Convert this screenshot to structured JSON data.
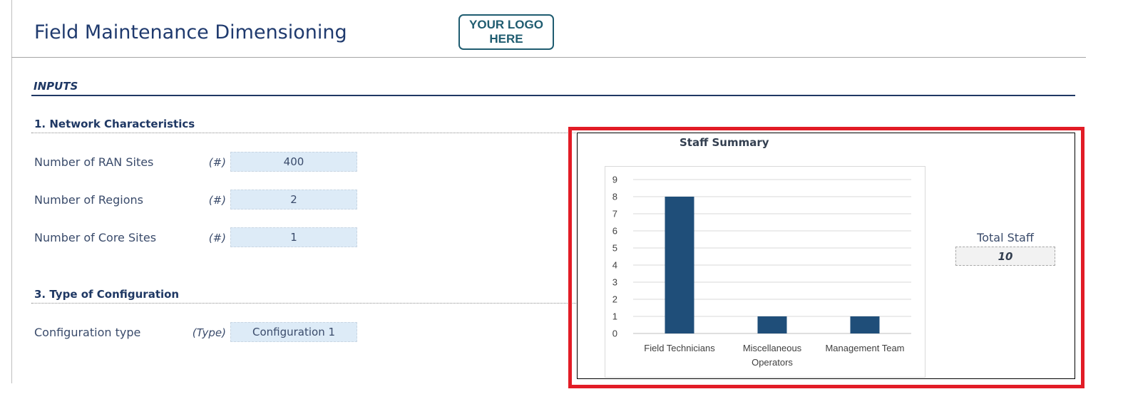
{
  "header": {
    "title": "Field Maintenance Dimensioning",
    "logo_line1": "YOUR LOGO",
    "logo_line2": "HERE"
  },
  "inputs_label": "INPUTS",
  "sections": [
    {
      "title": "1. Network Characteristics",
      "rows": [
        {
          "label": "Number of RAN Sites",
          "unit": "(#)",
          "value": "400"
        },
        {
          "label": "Number of Regions",
          "unit": "(#)",
          "value": "2"
        },
        {
          "label": "Number of Core Sites",
          "unit": "(#)",
          "value": "1"
        }
      ]
    },
    {
      "title": "3. Type of Configuration",
      "rows": [
        {
          "label": "Configuration type",
          "unit": "(Type)",
          "value": "Configuration 1"
        }
      ]
    }
  ],
  "summary": {
    "total_label": "Total Staff",
    "total_value": "10"
  },
  "colors": {
    "bar": "#1f4e79",
    "highlight": "#e21c26",
    "input_fill": "#ddebf7"
  },
  "chart_data": {
    "type": "bar",
    "title": "Staff Summary",
    "categories": [
      "Field Technicians",
      "Miscellaneous Operators",
      "Management Team"
    ],
    "category_lines": [
      [
        "Field Technicians"
      ],
      [
        "Miscellaneous",
        "Operators"
      ],
      [
        "Management Team"
      ]
    ],
    "values": [
      8,
      1,
      1
    ],
    "ylim": [
      0,
      9
    ],
    "yticks": [
      0,
      1,
      2,
      3,
      4,
      5,
      6,
      7,
      8,
      9
    ],
    "xlabel": "",
    "ylabel": "",
    "grid": true,
    "legend": "none"
  }
}
